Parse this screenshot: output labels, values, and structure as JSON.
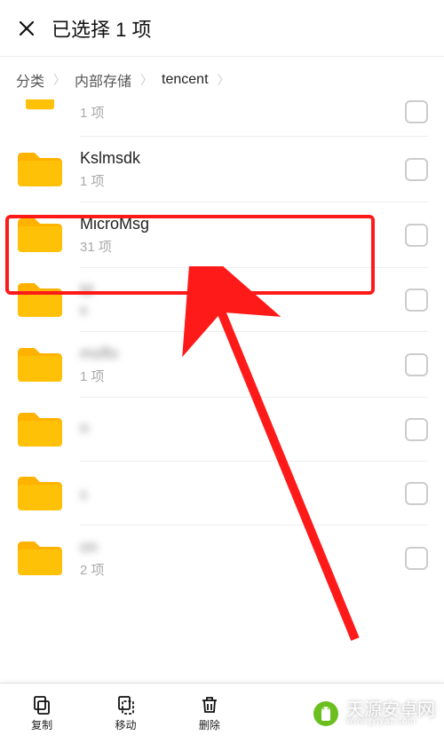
{
  "header": {
    "title": "已选择 1 项"
  },
  "breadcrumb": {
    "items": [
      "分类",
      "内部存储",
      "tencent"
    ]
  },
  "files": [
    {
      "name": "",
      "sub": "1 项",
      "partial": true,
      "blurName": false,
      "blurSub": false
    },
    {
      "name": "Kslmsdk",
      "sub": "1 项",
      "partial": false,
      "blurName": false,
      "blurSub": false
    },
    {
      "name": "MicroMsg",
      "sub": "31 项",
      "partial": false,
      "blurName": false,
      "blurSub": false,
      "highlighted": true
    },
    {
      "name": "M",
      "sub": "6",
      "partial": false,
      "blurName": true,
      "blurSub": true
    },
    {
      "name": "msflo",
      "sub": "1 项",
      "partial": false,
      "blurName": true,
      "blurSub": false
    },
    {
      "name": "n",
      "sub": " ",
      "partial": false,
      "blurName": true,
      "blurSub": true
    },
    {
      "name": " ",
      "sub": "5",
      "partial": false,
      "blurName": true,
      "blurSub": true
    },
    {
      "name": "on",
      "sub": "2 项",
      "partial": false,
      "blurName": true,
      "blurSub": false
    }
  ],
  "actions": {
    "copy": "复制",
    "move": "移动",
    "delete": "删除"
  },
  "watermark": {
    "main": "天源安卓网",
    "sub": "www.jytyaz.com"
  }
}
